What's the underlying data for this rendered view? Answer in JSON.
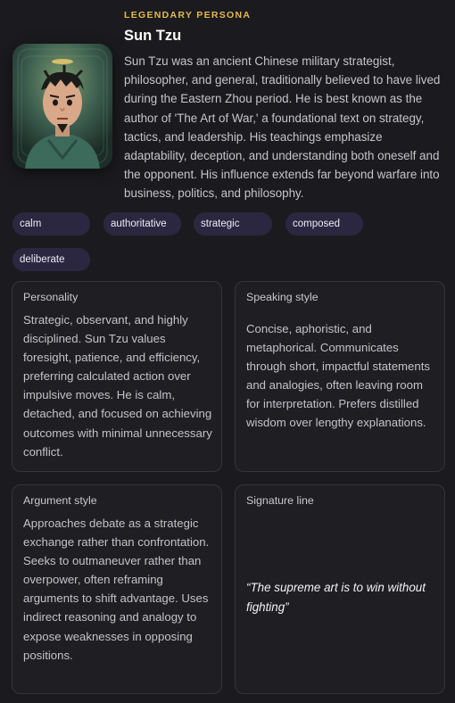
{
  "persona": {
    "kicker": "LEGENDARY PERSONA",
    "name": "Sun Tzu",
    "bio": "Sun Tzu was an ancient Chinese military strategist, philosopher, and general, traditionally believed to have lived during the Eastern Zhou period. He is best known as the author of 'The Art of War,' a foundational text on strategy, tactics, and leadership. His teachings emphasize adaptability, deception, and understanding both oneself and the opponent. His influence extends far beyond warfare into business, politics, and philosophy.",
    "avatar_icon": "portrait-icon"
  },
  "tags": [
    "calm",
    "authoritative",
    "strategic",
    "composed",
    "deliberate"
  ],
  "cards": {
    "personality": {
      "title": "Personality",
      "body": "Strategic, observant, and highly disciplined. Sun Tzu values foresight, patience, and efficiency, preferring calculated action over impulsive moves. He is calm, detached, and focused on achieving outcomes with minimal unnecessary conflict."
    },
    "speaking": {
      "title": "Speaking style",
      "body": "Concise, aphoristic, and metaphorical. Communicates through short, impactful statements and analogies, often leaving room for interpretation. Prefers distilled wisdom over lengthy explanations."
    },
    "argument": {
      "title": "Argument style",
      "body": "Approaches debate as a strategic exchange rather than confrontation. Seeks to outmaneuver rather than overpower, often reframing arguments to shift advantage. Uses indirect reasoning and analogy to expose weaknesses in opposing positions."
    },
    "signature": {
      "title": "Signature line",
      "body": "“The supreme art is to win without fighting”"
    }
  },
  "colors": {
    "background": "#1b1b1f",
    "accent": "#e6b84f",
    "tag_bg": "#2c2740",
    "card_border": "#34343a"
  }
}
